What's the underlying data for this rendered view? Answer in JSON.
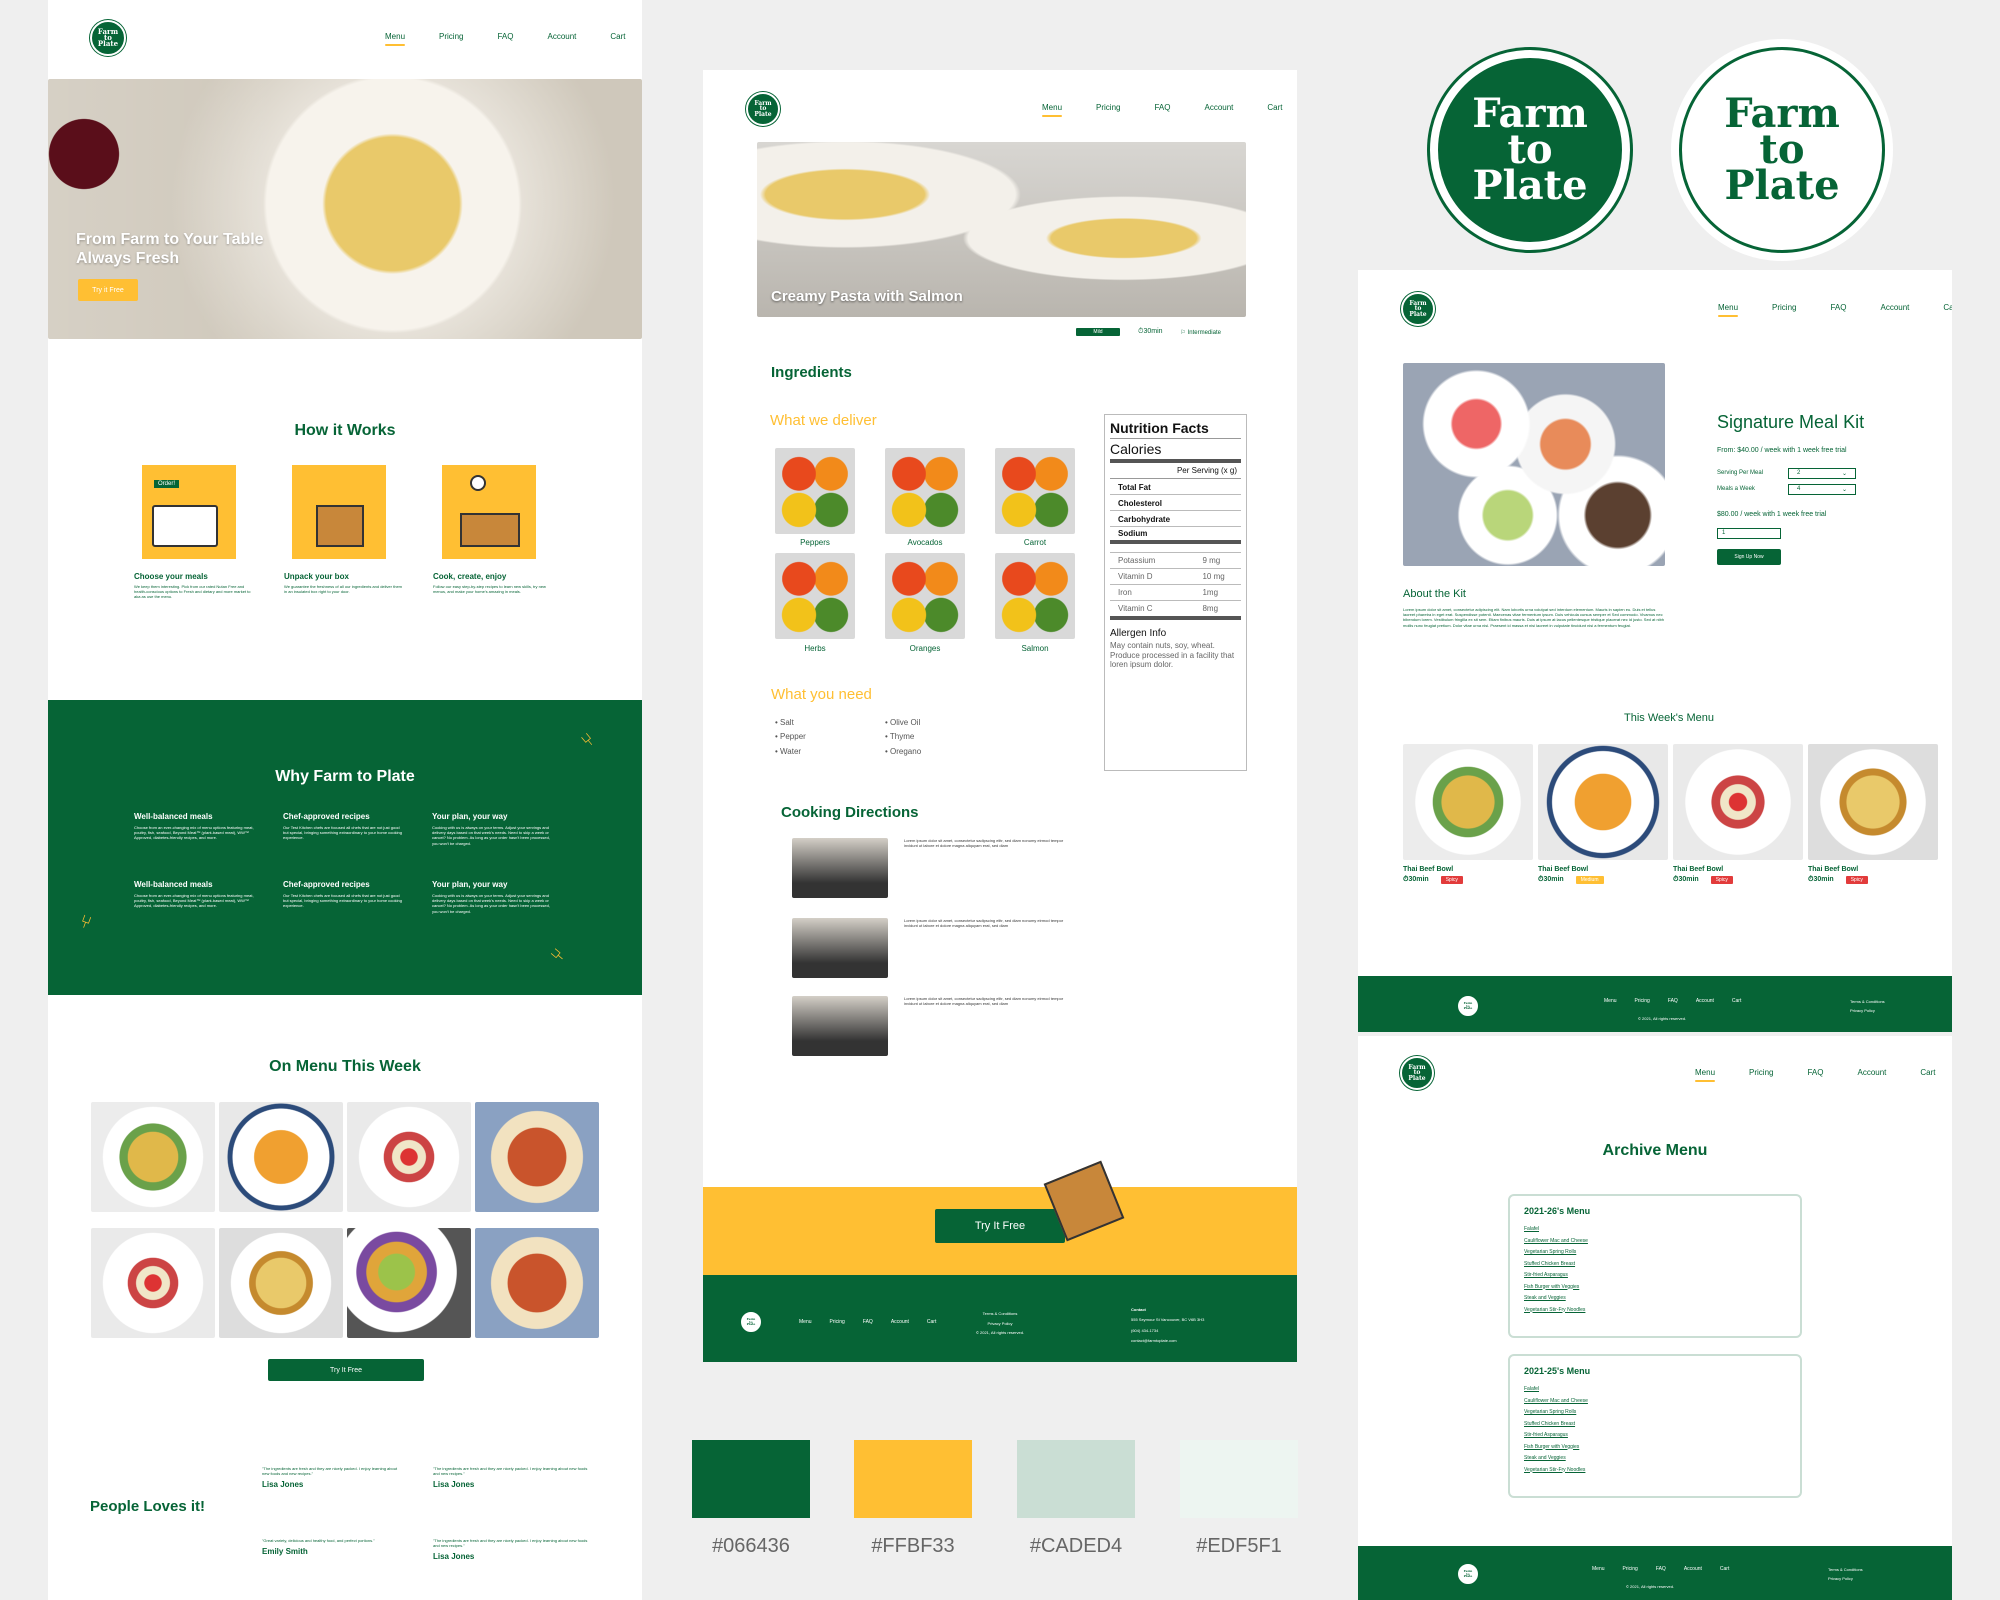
{
  "brand": {
    "logo_line1": "Farm",
    "logo_line2": "to",
    "logo_line3": "Plate"
  },
  "nav": {
    "menu": "Menu",
    "pricing": "Pricing",
    "faq": "FAQ",
    "account": "Account",
    "cart": "Cart"
  },
  "home": {
    "hero_line1": "From Farm to Your Table",
    "hero_line2": "Always Fresh",
    "hero_button": "Try it Free",
    "how_title": "How it Works",
    "how_steps": [
      {
        "title": "Choose your meals",
        "order_tag": "Order!",
        "text": "We keep them interesting. Pick from our rated Nutan Free and health-conscious options to Fresh and dietary and more market to aka as use the menu."
      },
      {
        "title": "Unpack your box",
        "text": "We guarantee the freshness of all our ingredients and deliver them in an insulated box right to your door."
      },
      {
        "title": "Cook, create, enjoy",
        "text": "Follow our easy step-by-step recipes to learn new skills, try new menus, and make your home's amazing in meals."
      }
    ],
    "why_title": "Why Farm to Plate",
    "why_items": [
      {
        "title": "Well-balanced meals",
        "text": "Choose from an ever-changing mix of menu options featuring meat, poultry, fish, seafood, Beyond Meat™ (plant-based meat), WW™ Approved, diabetes-friendly recipes, and more."
      },
      {
        "title": "Chef-approved recipes",
        "text": "Our Test Kitchen chefs are focused all chefs that are not just good but special, bringing something extraordinary to your home cooking experience."
      },
      {
        "title": "Your plan, your way",
        "text": "Cooking with us is always on your terms. Adjust your servings and delivery days based on that week's needs. Need to skip a week or cancel? No problem. As long as your order hasn't been processed, you won't be charged."
      },
      {
        "title": "Well-balanced meals",
        "text": "Choose from an ever-changing mix of menu options featuring meat, poultry, fish, seafood, Beyond Meat™ (plant-based meat), WW™ Approved, diabetes-friendly recipes, and more."
      },
      {
        "title": "Chef-approved recipes",
        "text": "Our Test Kitchen chefs are focused all chefs that are not just good but special, bringing something extraordinary to your home cooking experience."
      },
      {
        "title": "Your plan, your way",
        "text": "Cooking with us is always on your terms. Adjust your servings and delivery days based on that week's needs. Need to skip a week or cancel? No problem. As long as your order hasn't been processed, you won't be charged."
      }
    ],
    "on_menu_title": "On Menu This Week",
    "try_button": "Try It Free",
    "people_title": "People Loves it!",
    "testimonials": [
      {
        "quote": "\"The ingredients are fresh and they are nicely packed. I enjoy learning about new foods and new recipes.\"",
        "name": "Lisa Jones"
      },
      {
        "quote": "\"The ingredients are fresh and they are nicely packed. I enjoy learning about new foods and new recipes.\"",
        "name": "Lisa Jones"
      },
      {
        "quote": "\"Great variety, delicious and healthy food, and perfect portions.\"",
        "name": "Emily Smith"
      },
      {
        "quote": "\"The ingredients are fresh and they are nicely packed. I enjoy learning about new foods and new recipes.\"",
        "name": "Lisa Jones"
      }
    ]
  },
  "recipe": {
    "hero_title": "Creamy Pasta with Salmon",
    "tag_mild": "Mild",
    "time": "30min",
    "level": "Intermediate",
    "ingredients_title": "Ingredients",
    "deliver_title": "What we deliver",
    "deliver_items": [
      "Peppers",
      "Avocados",
      "Carrot",
      "Herbs",
      "Oranges",
      "Salmon"
    ],
    "need_title": "What you need",
    "need_col1": [
      "• Salt",
      "• Pepper",
      "• Water"
    ],
    "need_col2": [
      "• Olive Oil",
      "• Thyme",
      "• Oregano"
    ],
    "nutrition": {
      "title": "Nutrition Facts",
      "calories": "Calories",
      "per_serving": "Per Serving (x g)",
      "rows_bold": [
        "Total Fat",
        "Cholesterol",
        "Carbohydrate",
        "Sodium"
      ],
      "rows_minor": [
        [
          "Potassium",
          "9 mg"
        ],
        [
          "Vitamin D",
          "10 mg"
        ],
        [
          "Iron",
          "1mg"
        ],
        [
          "Vitamin C",
          "8mg"
        ]
      ],
      "allergen_title": "Allergen Info",
      "allergen_text": "May contain nuts, soy, wheat. Produce processed in a facility that loren ipsum dolor."
    },
    "directions_title": "Cooking Directions",
    "direction_text": "Lorem ipsum dolor sit amet, consectetur sadipscing elitr, sed diam nonumy eirmod tempor invidunt ut labore et dolore magna aliquyam erat, sed diam",
    "cta_button": "Try It Free",
    "footer": {
      "links": [
        "Menu",
        "Pricing",
        "FAQ",
        "Account",
        "Cart"
      ],
      "terms": "Terms & Conditions",
      "privacy": "Privacy Policy",
      "rights": "© 2021, All rights reserved.",
      "contact_title": "Contact",
      "address": "555 Seymour St Vancouver, BC V6B 3H3",
      "phone": "(604) 434-1734",
      "email": "contact@farmtoplate.com"
    }
  },
  "kit": {
    "title": "Signature Meal Kit",
    "price_line": "From: $40.00 / week with 1 week free trial",
    "servings_label": "Serving Per Meal",
    "servings_value": "2",
    "meals_label": "Meals a Week",
    "meals_value": "4",
    "total_line": "$80.00 / week with 1 week free trial",
    "qty": "1",
    "signup": "Sign Up Now",
    "about_title": "About the Kit",
    "about_text": "Lorem ipsum dolor sit amet, consectetur adipiscing elit. Nam lobortis urna volutpat sed interdum elementum. Mauris in sapien eu. Duis et tellus laoreet pharetra in eget erat. Suspendisse potenti. Maecenas vitae fermentum ipsum. Duis vehicula cursus semper et Sed commodo. Vivamus nec bibendum lorem. Vestibulum fringilla ex sit sem. Etiam finibus mauris. Duis at ipsum at lacus pellentesque tristique placerat nec id justo. Sed at nibh mollis nunc feugiat pretium. Dolor vitae urna nisl. Praesent id massa et nisi laoreet in vulputate tincidunt nisi a fermentum feugiat.",
    "week_title": "This Week's Menu",
    "week_items": [
      {
        "name": "Thai Beef Bowl",
        "time": "30min",
        "tag": "Spicy",
        "tag_color": "#e23b3b"
      },
      {
        "name": "Thai Beef Bowl",
        "time": "30min",
        "tag": "Medium",
        "tag_color": "#FFBF33"
      },
      {
        "name": "Thai Beef Bowl",
        "time": "30min",
        "tag": "Spicy",
        "tag_color": "#e23b3b"
      },
      {
        "name": "Thai Beef Bowl",
        "time": "30min",
        "tag": "Spicy",
        "tag_color": "#e23b3b"
      }
    ],
    "footer_links": [
      "Menu",
      "Pricing",
      "FAQ",
      "Account",
      "Cart"
    ],
    "footer_terms": "Terms & Conditions",
    "footer_privacy": "Privacy Policy",
    "footer_rights": "© 2021, All rights reserved."
  },
  "archive": {
    "title": "Archive Menu",
    "box1_title": "2021-26's Menu",
    "box2_title": "2021-25's Menu",
    "items": [
      "Falafel",
      "Cauliflower Mac and Cheese",
      "Vegetarian Spring Rolls",
      "Stuffed Chicken Breast",
      "Stir-fried Asparagus",
      "Fish Burger with Veggies",
      "Steak and Veggies",
      "Vegetarian Stir-Fry Noodles"
    ],
    "footer_links": [
      "Menu",
      "Pricing",
      "FAQ",
      "Account",
      "Cart"
    ],
    "footer_terms": "Terms & Conditions",
    "footer_privacy": "Privacy Policy",
    "footer_rights": "© 2021, All rights reserved."
  },
  "palette": [
    {
      "hex": "#066436",
      "label": "#066436"
    },
    {
      "hex": "#FFBF33",
      "label": "#FFBF33"
    },
    {
      "hex": "#CADED4",
      "label": "#CADED4"
    },
    {
      "hex": "#EDF5F1",
      "label": "#EDF5F1"
    }
  ]
}
